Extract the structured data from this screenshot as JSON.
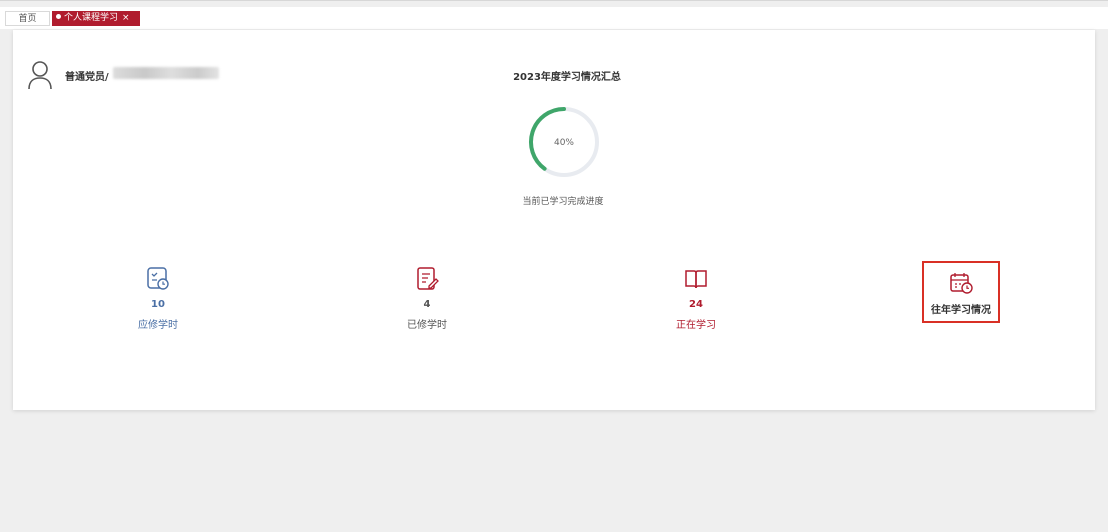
{
  "tabs": {
    "home": "首页",
    "active": "个人课程学习",
    "close": "×"
  },
  "user": {
    "name_prefix": "普通党员/"
  },
  "summary": {
    "title": "2023年度学习情况汇总",
    "progress_percent": 40,
    "progress_text": "40%",
    "progress_label": "当前已学习完成进度"
  },
  "stats": [
    {
      "value": "10",
      "label": "应修学时",
      "color": "#4a6fa5",
      "icon": "checklist-clock-icon"
    },
    {
      "value": "4",
      "label": "已修学时",
      "color": "#555555",
      "icon": "edit-document-icon"
    },
    {
      "value": "24",
      "label": "正在学习",
      "color": "#b01c2e",
      "icon": "open-book-icon"
    }
  ],
  "history": {
    "label": "往年学习情况",
    "icon": "calendar-clock-icon"
  },
  "colors": {
    "brand": "#b01c2e",
    "progress": "#3fa66a",
    "highlight_border": "#d93025"
  }
}
